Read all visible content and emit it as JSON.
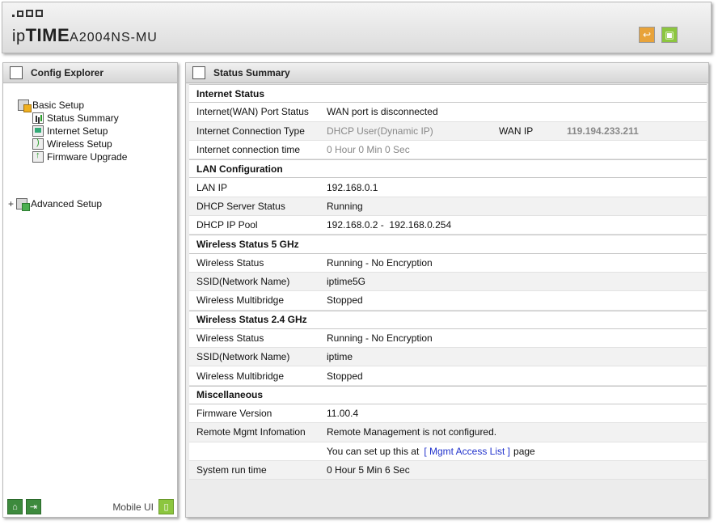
{
  "header": {
    "brand": "ipTIME",
    "brand_prefix": "ip",
    "brand_bold": "TIME",
    "model": "A2004NS-MU",
    "buttons": [
      "restore-icon",
      "save-icon"
    ]
  },
  "left_panel": {
    "title": "Config Explorer",
    "tree": {
      "basic_setup": "Basic Setup",
      "status_summary": "Status Summary",
      "internet_setup": "Internet Setup",
      "wireless_setup": "Wireless Setup",
      "firmware_upgrade": "Firmware Upgrade",
      "advanced_setup": "Advanced Setup",
      "expand_symbol": "+"
    },
    "footer": {
      "mobile_label": "Mobile UI"
    }
  },
  "right_panel": {
    "title": "Status Summary",
    "sections": {
      "internet": "Internet Status",
      "lan": "LAN Configuration",
      "w5": "Wireless Status 5 GHz",
      "w24": "Wireless Status 2.4 GHz",
      "misc": "Miscellaneous"
    },
    "internet": {
      "port_label": "Internet(WAN) Port Status",
      "port_value": "WAN port is disconnected",
      "conn_type_label": "Internet Connection Type",
      "conn_type_value": "DHCP User(Dynamic IP)",
      "wan_ip_label": "WAN IP",
      "wan_ip_value": "119.194.233.211",
      "conn_time_label": "Internet connection time",
      "conn_time_value": "0 Hour 0 Min 0 Sec"
    },
    "lan": {
      "ip_label": "LAN IP",
      "ip_value": "192.168.0.1",
      "dhcp_label": "DHCP Server Status",
      "dhcp_value": "Running",
      "pool_label": "DHCP IP Pool",
      "pool_value": "192.168.0.2 -  192.168.0.254"
    },
    "w5": {
      "status_label": "Wireless Status",
      "status_value": "Running - No Encryption",
      "ssid_label": "SSID(Network Name)",
      "ssid_value": "iptime5G",
      "mb_label": "Wireless Multibridge",
      "mb_value": "Stopped"
    },
    "w24": {
      "status_label": "Wireless Status",
      "status_value": "Running - No Encryption",
      "ssid_label": "SSID(Network Name)",
      "ssid_value": "iptime",
      "mb_label": "Wireless Multibridge",
      "mb_value": "Stopped"
    },
    "misc": {
      "fw_label": "Firmware Version",
      "fw_value": "11.00.4",
      "remote_label": "Remote Mgmt Infomation",
      "remote_value": "Remote Management is not configured.",
      "setup_prefix": "You can set up this at",
      "setup_link": "[ Mgmt Access List ]",
      "setup_suffix": "page",
      "runtime_label": "System run time",
      "runtime_value": "0 Hour 5 Min 6 Sec"
    }
  }
}
